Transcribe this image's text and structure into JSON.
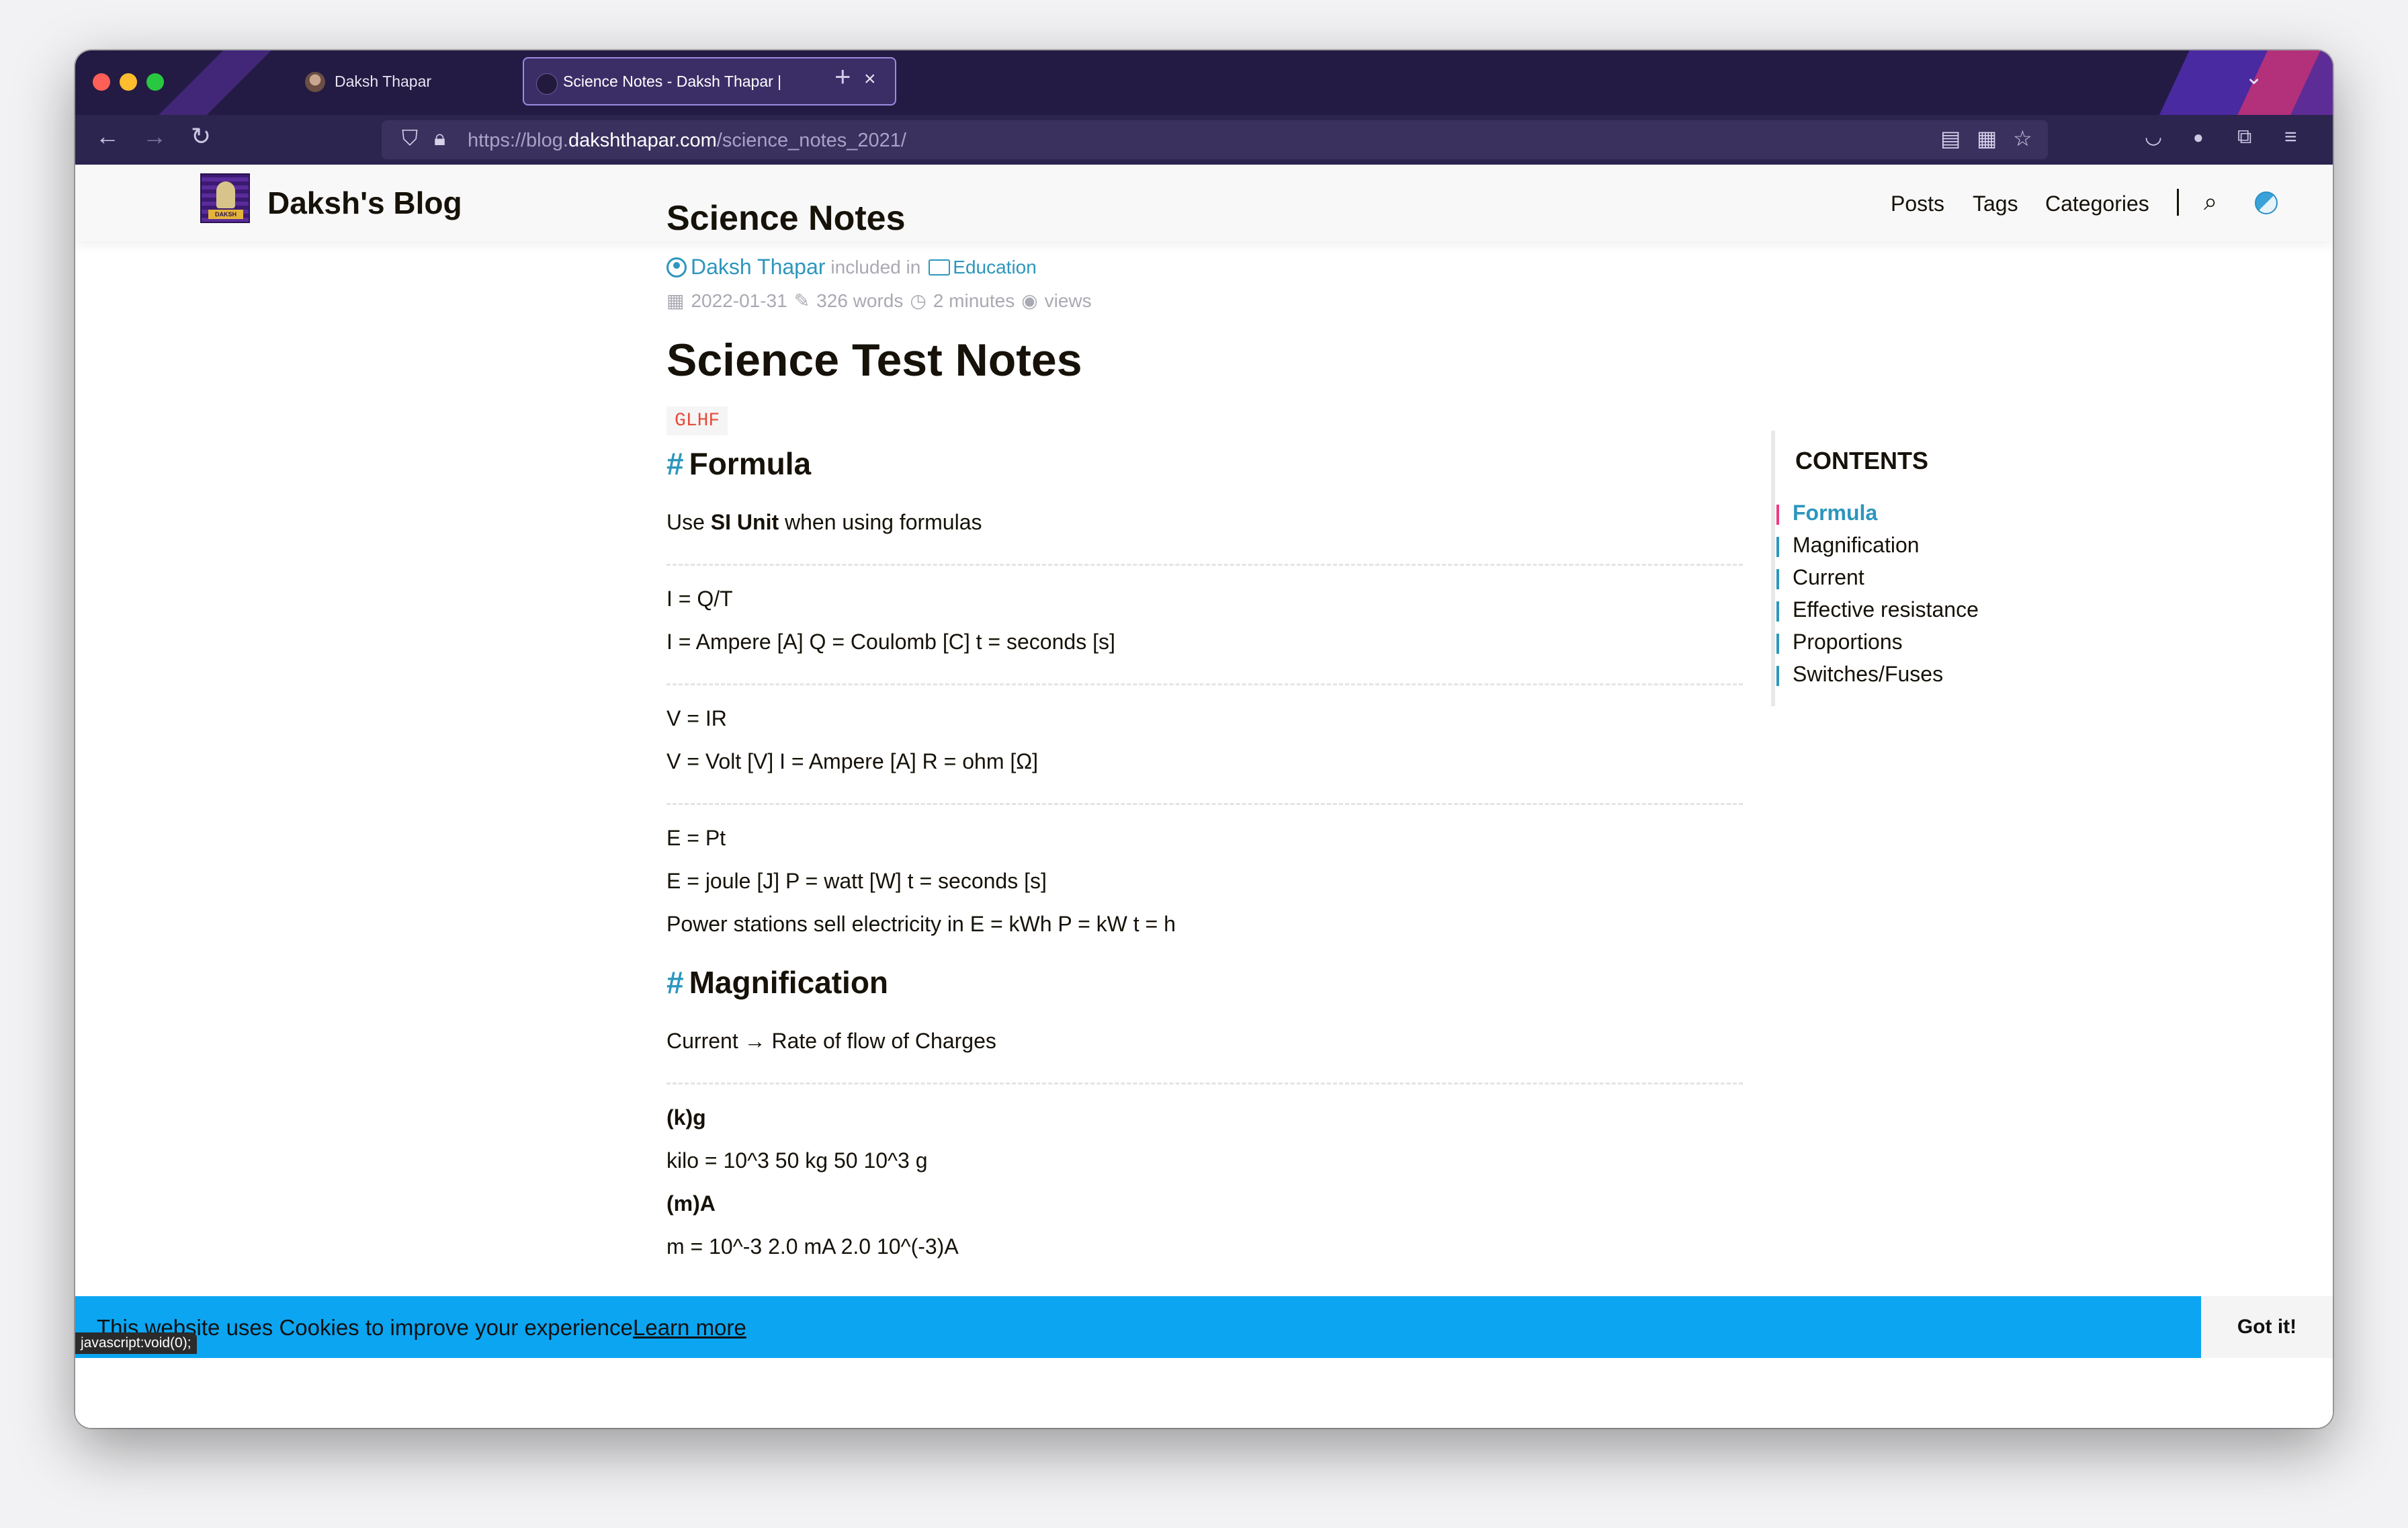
{
  "browser": {
    "tabs": [
      {
        "title": "Daksh Thapar",
        "close": "×"
      },
      {
        "title": "Science Notes - Daksh Thapar |",
        "close": "×"
      }
    ],
    "new_tab": "+",
    "url_prefix": "https://blog.",
    "url_host": "dakshthapar.com",
    "url_path": "/science_notes_2021/",
    "status_text": "javascript:void(0);"
  },
  "site": {
    "title": "Daksh's Blog",
    "logo_text": "DAKSH",
    "menu": [
      "Posts",
      "Tags",
      "Categories"
    ]
  },
  "post": {
    "title": "Science Notes",
    "author": "Daksh Thapar",
    "included_in": "included in",
    "category": "Education",
    "date": "2022-01-31",
    "words": "326 words",
    "read_time": "2 minutes",
    "views": "views",
    "heading": "Science Test Notes",
    "tag": "GLHF",
    "sections": {
      "formula": "Formula",
      "magnification": "Magnification"
    },
    "lines": {
      "si_pre": "Use ",
      "si_bold": "SI Unit",
      "si_post": " when using formulas",
      "l1": "I = Q/T",
      "l2": "I = Ampere [A] Q = Coulomb [C] t = seconds [s]",
      "l3": "V = IR",
      "l4": "V = Volt [V] I = Ampere [A] R = ohm [Ω]",
      "l5": "E = Pt",
      "l6": "E = joule [J] P = watt [W] t = seconds [s]",
      "l7": "Power stations sell electricity in E = kWh P = kW t = h",
      "l8": "Current → Rate of flow of Charges",
      "l9": "(k)g",
      "l10": "kilo = 10^3 50 kg 50 10^3 g",
      "l11": "(m)A",
      "l12": "m = 10^-3 2.0 mA 2.0 10^(-3)A"
    }
  },
  "toc": {
    "title": "CONTENTS",
    "items": [
      "Formula",
      "Magnification",
      "Current",
      "Effective resistance",
      "Proportions",
      "Switches/Fuses"
    ]
  },
  "cookie": {
    "message": "This website uses Cookies to improve your experience.",
    "learn_more": "Learn more",
    "accept": "Got it!"
  },
  "colors": {
    "accent": "#2d96bd",
    "toc_active_bar": "#ef3982",
    "cookie_bar": "#0ba5f2",
    "chrome_dark": "#231b43"
  }
}
